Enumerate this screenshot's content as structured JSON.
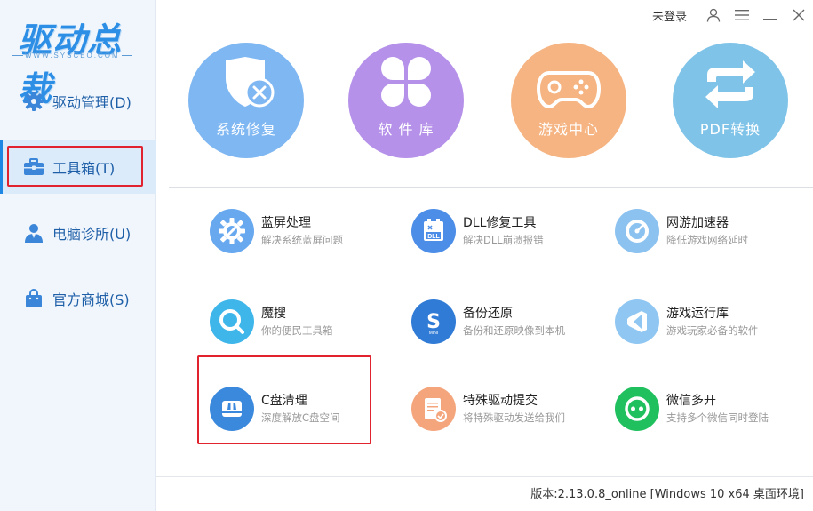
{
  "logo": {
    "text": "驱动总裁",
    "subtitle": "WWW.SYSCEO.COM"
  },
  "sidebar": {
    "items": [
      {
        "label": "驱动管理(D)",
        "icon": "gear-icon"
      },
      {
        "label": "工具箱(T)",
        "icon": "toolbox-icon"
      },
      {
        "label": "电脑诊所(U)",
        "icon": "doctor-icon"
      },
      {
        "label": "官方商城(S)",
        "icon": "shopping-bag-icon"
      }
    ],
    "active_index": 1
  },
  "titlebar": {
    "login_text": "未登录"
  },
  "features": [
    {
      "label": "系统修复",
      "icon": "shield-wrench-icon",
      "color": "#7fb7f2"
    },
    {
      "label": "软 件 库",
      "icon": "clover-icon",
      "color": "#b591ea"
    },
    {
      "label": "游戏中心",
      "icon": "gamepad-icon",
      "color": "#f5b482"
    },
    {
      "label": "PDF转换",
      "icon": "convert-arrows-icon",
      "color": "#7fc3e8"
    }
  ],
  "tools": [
    {
      "title": "蓝屏处理",
      "desc": "解决系统蓝屏问题",
      "icon": "gear-wrench-icon",
      "color": "#67a8ef"
    },
    {
      "title": "DLL修复工具",
      "desc": "解决DLL崩溃报错",
      "icon": "dll-icon",
      "color": "#4c8de8"
    },
    {
      "title": "网游加速器",
      "desc": "降低游戏网络延时",
      "icon": "speedometer-icon",
      "color": "#8cc2f0"
    },
    {
      "title": "魔搜",
      "desc": "你的便民工具箱",
      "icon": "search-icon",
      "color": "#3fb6ea"
    },
    {
      "title": "备份还原",
      "desc": "备份和还原映像到本机",
      "icon": "backup-icon",
      "color": "#2f7bd6"
    },
    {
      "title": "游戏运行库",
      "desc": "游戏玩家必备的软件",
      "icon": "runtime-icon",
      "color": "#8fc6f2"
    },
    {
      "title": "C盘清理",
      "desc": "深度解放C盘空间",
      "icon": "disk-clean-icon",
      "color": "#3b89dc"
    },
    {
      "title": "特殊驱动提交",
      "desc": "将特殊驱动发送给我们",
      "icon": "document-check-icon",
      "color": "#f4a57c"
    },
    {
      "title": "微信多开",
      "desc": "支持多个微信同时登陆",
      "icon": "wechat-icon",
      "color": "#21c05f"
    }
  ],
  "footer": {
    "version": "版本:2.13.0.8_online [Windows 10 x64 桌面环境]"
  }
}
